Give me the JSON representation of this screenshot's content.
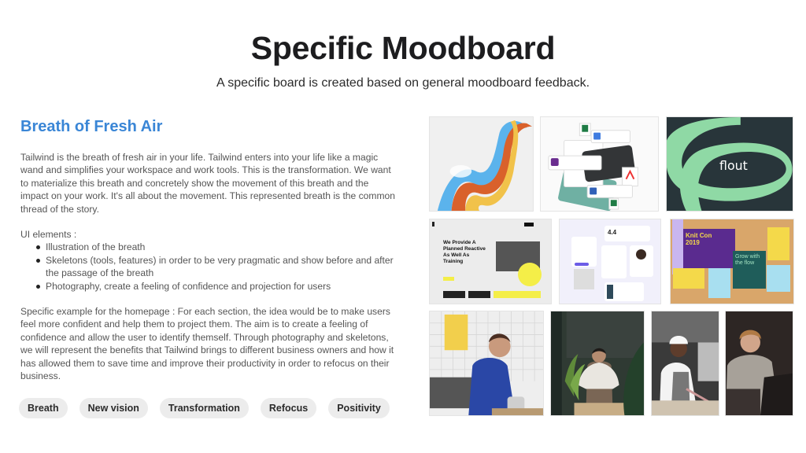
{
  "header": {
    "title": "Specific Moodboard",
    "subtitle": "A specific board is created based on general moodboard feedback."
  },
  "section": {
    "title": "Breath of Fresh Air",
    "intro": "Tailwind is the breath of fresh air in your life. Tailwind enters into your life like a magic wand and simplifies your workspace and work tools. This is the transformation. We want to materialize this breath and concretely show the movement of this breath and the impact on your work. It's all about the movement. This represented breath is the common thread of the story.",
    "ui_elements_label": "UI elements :",
    "ui_elements": [
      "Illustration of the breath",
      "Skeletons (tools, features) in order to be very pragmatic and show before and after the passage of the breath",
      "Photography, create a feeling of confidence and projection for users"
    ],
    "example": "Specific example for the homepage : For each section, the idea would be to make users feel more confident and help them to project them. The aim is to create a feeling of confidence and allow the user to identify themself. Through photography and skeletons, we will represent the benefits that Tailwind brings to different business owners and how it has allowed them to save time and improve their productivity in order to refocus on their business."
  },
  "tags": [
    "Breath",
    "New vision",
    "Transformation",
    "Refocus",
    "Positivity"
  ],
  "moodboard": {
    "accent_color": "#3a86d6",
    "tiles": [
      {
        "name": "breath-ribbon-illustration",
        "description": "Flowing ribbons in blue, orange and yellow"
      },
      {
        "name": "floating-cards-skeleton",
        "description": "Floating app notification cards and payment cards"
      },
      {
        "name": "flout-brand-illustration",
        "text": "flout"
      },
      {
        "name": "landing-page-skeleton",
        "headline": "We Provide A Planned Reactive As Well As Training"
      },
      {
        "name": "dashboard-widgets-skeleton",
        "rating": "4.4"
      },
      {
        "name": "knit-con-poster",
        "title": "Knit Con 2019",
        "slogan": "Grow with the flow"
      },
      {
        "name": "barista-photo",
        "description": "Man in blue jacket in a cafe"
      },
      {
        "name": "florist-photo",
        "description": "Woman in apron behind a counter"
      },
      {
        "name": "chef-photo",
        "description": "Chef cooking in a kitchen"
      },
      {
        "name": "laptop-user-photo",
        "description": "Person smiling at a laptop"
      }
    ]
  }
}
